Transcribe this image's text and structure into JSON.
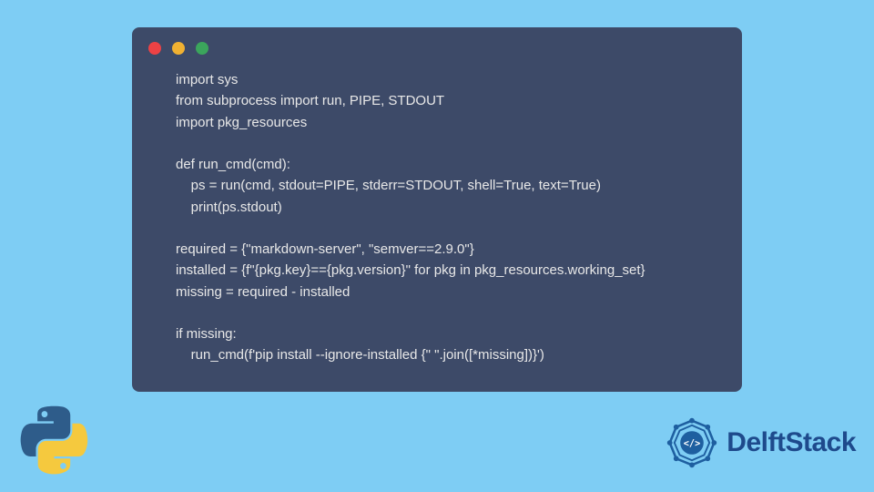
{
  "code": {
    "line1": "import sys",
    "line2": "from subprocess import run, PIPE, STDOUT",
    "line3": "import pkg_resources",
    "line4": "",
    "line5": "def run_cmd(cmd):",
    "line6": "    ps = run(cmd, stdout=PIPE, stderr=STDOUT, shell=True, text=True)",
    "line7": "    print(ps.stdout)",
    "line8": "",
    "line9": "required = {\"markdown-server\", \"semver==2.9.0\"}",
    "line10": "installed = {f\"{pkg.key}=={pkg.version}\" for pkg in pkg_resources.working_set}",
    "line11": "missing = required - installed",
    "line12": "",
    "line13": "if missing:",
    "line14": "    run_cmd(f'pip install --ignore-installed {\" \".join([*missing])}')"
  },
  "brand": {
    "name": "DelftStack"
  }
}
